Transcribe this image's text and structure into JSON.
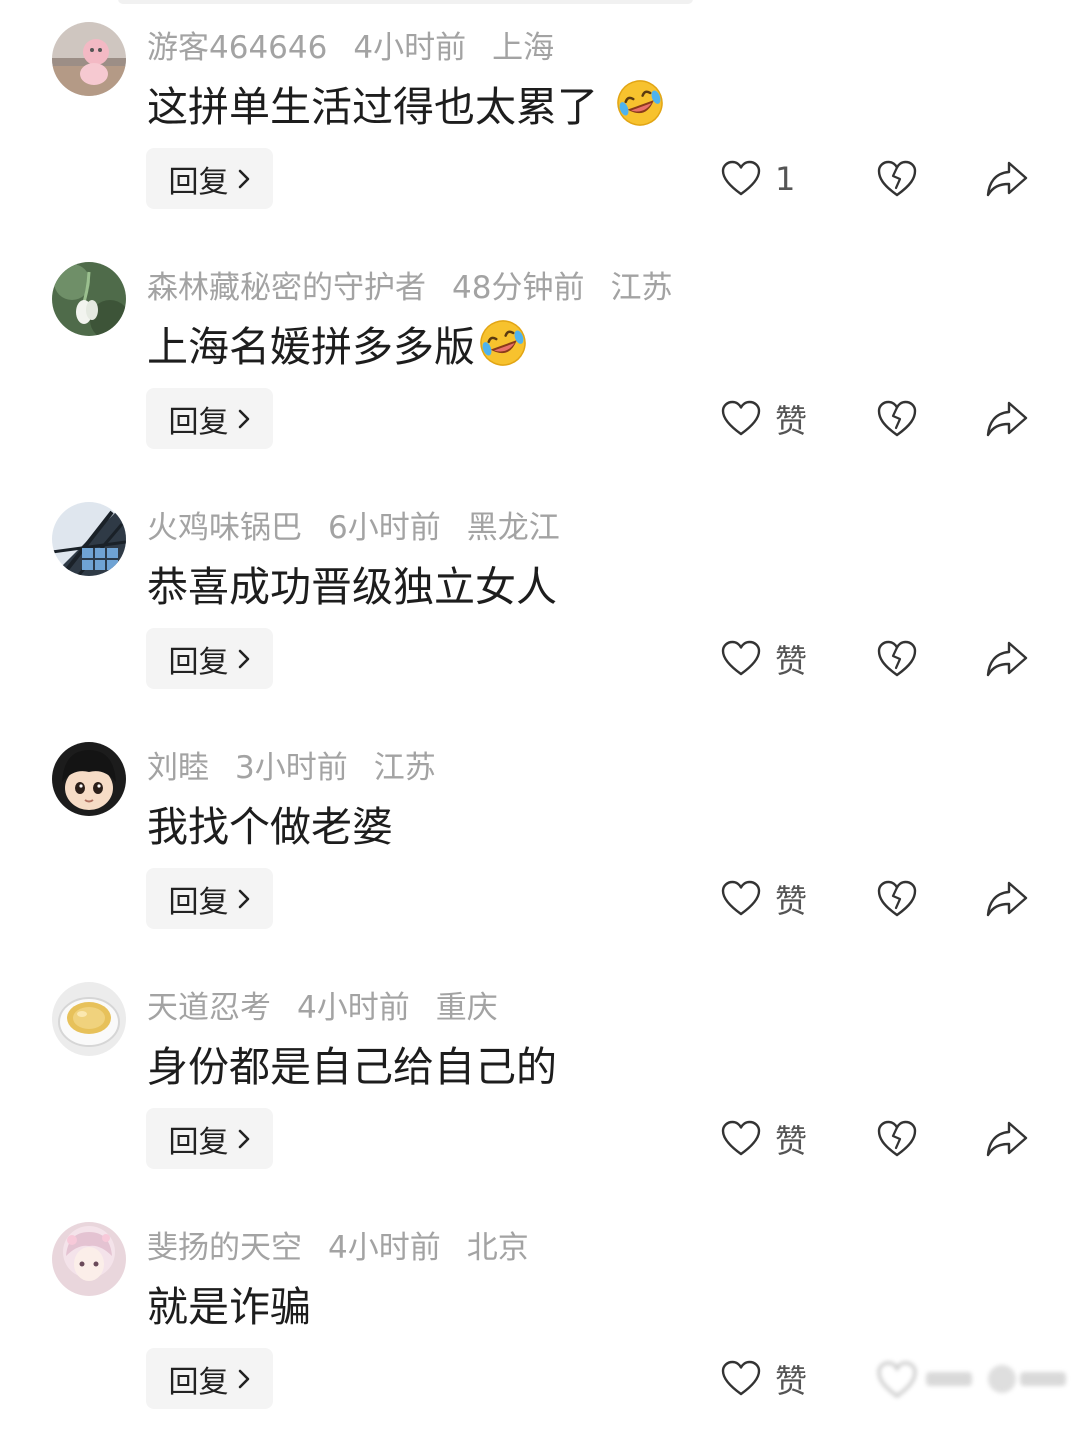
{
  "reply_label": "回复",
  "comments": [
    {
      "user": "游客464646",
      "time": "4小时前",
      "location": "上海",
      "text": "这拼单生活过得也太累了",
      "emoji": "rofl-emoji",
      "like_label": "1",
      "avatar": "pink-figure"
    },
    {
      "user": "森林藏秘密的守护者",
      "time": "48分钟前",
      "location": "江苏",
      "text": "上海名媛拼多多版",
      "emoji": "rofl-emoji",
      "like_label": "赞",
      "avatar": "snowdrop-flower"
    },
    {
      "user": "火鸡味锅巴",
      "time": "6小时前",
      "location": "黑龙江",
      "text": "恭喜成功晋级独立女人",
      "emoji": "",
      "like_label": "赞",
      "avatar": "glass-ceiling"
    },
    {
      "user": "刘睦",
      "time": "3小时前",
      "location": "江苏",
      "text": "我找个做老婆",
      "emoji": "",
      "like_label": "赞",
      "avatar": "cartoon-child"
    },
    {
      "user": "天道忍考",
      "time": "4小时前",
      "location": "重庆",
      "text": "身份都是自己给自己的",
      "emoji": "",
      "like_label": "赞",
      "avatar": "tea-cup"
    },
    {
      "user": "斐扬的天空",
      "time": "4小时前",
      "location": "北京",
      "text": "就是诈骗",
      "emoji": "",
      "like_label": "赞",
      "avatar": "anime-girl"
    }
  ],
  "colors": {
    "meta_text": "#a3a3a3",
    "body_text": "#1d1d1d",
    "reply_bg": "#f4f4f4",
    "icon_stroke": "#333333"
  }
}
